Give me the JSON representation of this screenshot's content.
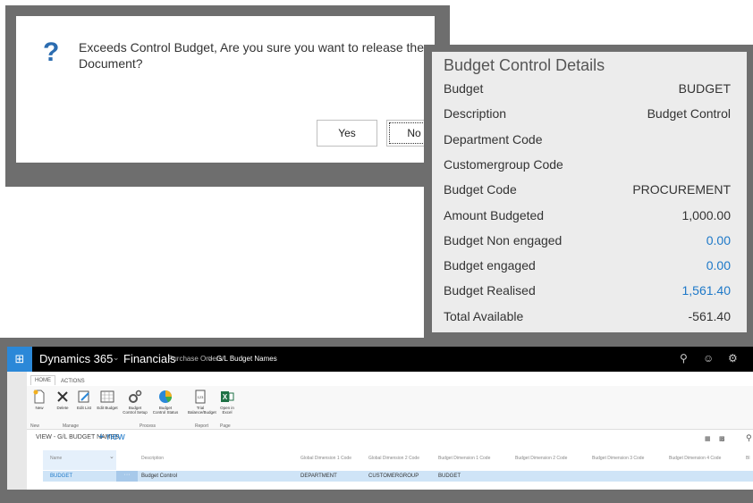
{
  "dialog": {
    "message": "Exceeds Control Budget, Are you sure you want to release the Document?",
    "yes_label": "Yes",
    "no_label": "No"
  },
  "budget_details": {
    "title": "Budget Control Details",
    "rows": [
      {
        "label": "Budget",
        "value": "BUDGET",
        "highlight": false
      },
      {
        "label": "Description",
        "value": "Budget Control",
        "highlight": false
      },
      {
        "label": "Department Code",
        "value": "",
        "highlight": false
      },
      {
        "label": "Customergroup Code",
        "value": "",
        "highlight": false
      },
      {
        "label": "Budget Code",
        "value": "PROCUREMENT",
        "highlight": false
      },
      {
        "label": "Amount Budgeted",
        "value": "1,000.00",
        "highlight": false
      },
      {
        "label": "Budget Non engaged",
        "value": "0.00",
        "highlight": true
      },
      {
        "label": "Budget engaged",
        "value": "0.00",
        "highlight": true
      },
      {
        "label": "Budget Realised",
        "value": "1,561.40",
        "highlight": true
      },
      {
        "label": "Total Available",
        "value": "-561.40",
        "highlight": false
      }
    ],
    "link_color": "#1d78c8"
  },
  "d365": {
    "app_name": "Dynamics 365",
    "module": "Financials",
    "breadcrumb_1": "Purchase Orders",
    "breadcrumb_sep": ">",
    "breadcrumb_2": "G/L Budget Names",
    "tabs": {
      "home": "HOME",
      "actions": "ACTIONS"
    },
    "ribbon": {
      "new": "New",
      "delete": "Delete",
      "edit_list": "Edit List",
      "edit_budget": "Edit Budget",
      "budget_control_setup": "Budget Control Setup",
      "budget_control_status": "Budget Control Status",
      "trial_balance": "Trial Balance/Budget",
      "open_excel": "Open in Excel",
      "groups": {
        "new": "New",
        "manage": "Manage",
        "process": "Process",
        "report": "Report",
        "page": "Page"
      }
    },
    "view_title": "VIEW - G/L BUDGET NAMES",
    "new_link": "+ new",
    "columns": [
      "Name",
      "Description",
      "Global Dimension 1 Code",
      "Global Dimension 2 Code",
      "Budget Dimension 1 Code",
      "Budget Dimension 2 Code",
      "Budget Dimension 3 Code",
      "Budget Dimension 4 Code",
      "Bl"
    ],
    "row": {
      "name": "BUDGET",
      "ellipsis": "···",
      "description": "Budget Control",
      "gd1": "DEPARTMENT",
      "gd2": "CUSTOMERGROUP",
      "bd1": "BUDGET"
    },
    "accent": "#2b88d8"
  }
}
